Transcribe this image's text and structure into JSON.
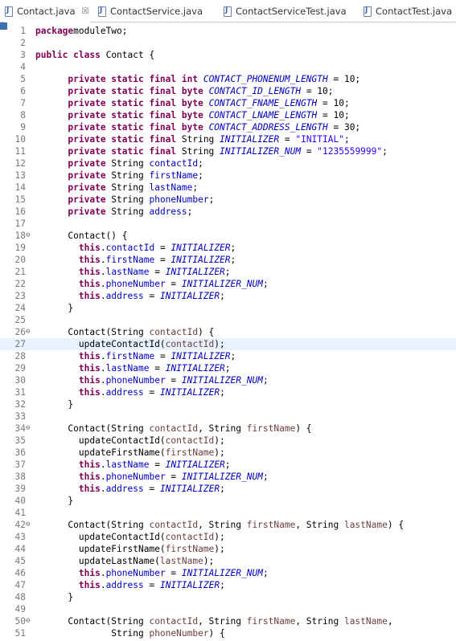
{
  "tabs": [
    {
      "label": "Contact.java",
      "close": "☒",
      "active": true
    },
    {
      "label": "ContactService.java"
    },
    {
      "label": "ContactServiceTest.java"
    },
    {
      "label": "ContactTest.java"
    }
  ],
  "current_line": 27,
  "lines": [
    {
      "n": "1",
      "t": [
        [
          "kw",
          "package"
        ],
        [
          "",
          "moduleTwo;"
        ]
      ]
    },
    {
      "n": "2",
      "t": []
    },
    {
      "n": "3",
      "t": [
        [
          "kw",
          "public"
        ],
        [
          "",
          ""
        ],
        [
          "kw",
          " class"
        ],
        [
          "",
          " Contact {"
        ]
      ]
    },
    {
      "n": "4",
      "t": []
    },
    {
      "n": "5",
      "t": [
        [
          "",
          "      "
        ],
        [
          "kw",
          "private static final int"
        ],
        [
          "",
          " "
        ],
        [
          "sfld",
          "CONTACT_PHONENUM_LENGTH"
        ],
        [
          "",
          " = 10;"
        ]
      ]
    },
    {
      "n": "6",
      "t": [
        [
          "",
          "      "
        ],
        [
          "kw",
          "private static final byte"
        ],
        [
          "",
          " "
        ],
        [
          "sfld",
          "CONTACT_ID_LENGTH"
        ],
        [
          "",
          " = 10;"
        ]
      ]
    },
    {
      "n": "7",
      "t": [
        [
          "",
          "      "
        ],
        [
          "kw",
          "private static final byte"
        ],
        [
          "",
          " "
        ],
        [
          "sfld",
          "CONTACT_FNAME_LENGTH"
        ],
        [
          "",
          " = 10;"
        ]
      ]
    },
    {
      "n": "8",
      "t": [
        [
          "",
          "      "
        ],
        [
          "kw",
          "private static final byte"
        ],
        [
          "",
          " "
        ],
        [
          "sfld",
          "CONTACT_LNAME_LENGTH"
        ],
        [
          "",
          " = 10;"
        ]
      ]
    },
    {
      "n": "9",
      "t": [
        [
          "",
          "      "
        ],
        [
          "kw",
          "private static final byte"
        ],
        [
          "",
          " "
        ],
        [
          "sfld",
          "CONTACT_ADDRESS_LENGTH"
        ],
        [
          "",
          " = 30;"
        ]
      ]
    },
    {
      "n": "10",
      "t": [
        [
          "",
          "      "
        ],
        [
          "kw",
          "private static final"
        ],
        [
          "",
          " String "
        ],
        [
          "sfld",
          "INITIALIZER"
        ],
        [
          "",
          " = "
        ],
        [
          "str",
          "\"INITIAL\""
        ],
        [
          "",
          ";"
        ]
      ]
    },
    {
      "n": "11",
      "t": [
        [
          "",
          "      "
        ],
        [
          "kw",
          "private static final"
        ],
        [
          "",
          " String "
        ],
        [
          "sfld",
          "INITIALIZER_NUM"
        ],
        [
          "",
          " = "
        ],
        [
          "str",
          "\"1235559999\""
        ],
        [
          "",
          ";"
        ]
      ]
    },
    {
      "n": "12",
      "t": [
        [
          "",
          "      "
        ],
        [
          "kw",
          "private"
        ],
        [
          "",
          " String "
        ],
        [
          "fld",
          "contactId"
        ],
        [
          "",
          ";"
        ]
      ]
    },
    {
      "n": "13",
      "t": [
        [
          "",
          "      "
        ],
        [
          "kw",
          "private"
        ],
        [
          "",
          " String "
        ],
        [
          "fld",
          "firstName"
        ],
        [
          "",
          ";"
        ]
      ]
    },
    {
      "n": "14",
      "t": [
        [
          "",
          "      "
        ],
        [
          "kw",
          "private"
        ],
        [
          "",
          " String "
        ],
        [
          "fld",
          "lastName"
        ],
        [
          "",
          ";"
        ]
      ]
    },
    {
      "n": "15",
      "t": [
        [
          "",
          "      "
        ],
        [
          "kw",
          "private"
        ],
        [
          "",
          " String "
        ],
        [
          "fld",
          "phoneNumber"
        ],
        [
          "",
          ";"
        ]
      ]
    },
    {
      "n": "16",
      "t": [
        [
          "",
          "      "
        ],
        [
          "kw",
          "private"
        ],
        [
          "",
          " String "
        ],
        [
          "fld",
          "address"
        ],
        [
          "",
          ";"
        ]
      ]
    },
    {
      "n": "17",
      "t": []
    },
    {
      "n": "18",
      "fold": "⊖",
      "t": [
        [
          "",
          "      Contact() {"
        ]
      ]
    },
    {
      "n": "19",
      "t": [
        [
          "",
          "        "
        ],
        [
          "kw",
          "this"
        ],
        [
          "",
          "."
        ],
        [
          "fld",
          "contactId"
        ],
        [
          "",
          " = "
        ],
        [
          "sfld",
          "INITIALIZER"
        ],
        [
          "",
          ";"
        ]
      ]
    },
    {
      "n": "20",
      "t": [
        [
          "",
          "        "
        ],
        [
          "kw",
          "this"
        ],
        [
          "",
          "."
        ],
        [
          "fld",
          "firstName"
        ],
        [
          "",
          " = "
        ],
        [
          "sfld",
          "INITIALIZER"
        ],
        [
          "",
          ";"
        ]
      ]
    },
    {
      "n": "21",
      "t": [
        [
          "",
          "        "
        ],
        [
          "kw",
          "this"
        ],
        [
          "",
          "."
        ],
        [
          "fld",
          "lastName"
        ],
        [
          "",
          " = "
        ],
        [
          "sfld",
          "INITIALIZER"
        ],
        [
          "",
          ";"
        ]
      ]
    },
    {
      "n": "22",
      "t": [
        [
          "",
          "        "
        ],
        [
          "kw",
          "this"
        ],
        [
          "",
          "."
        ],
        [
          "fld",
          "phoneNumber"
        ],
        [
          "",
          " = "
        ],
        [
          "sfld",
          "INITIALIZER_NUM"
        ],
        [
          "",
          ";"
        ]
      ]
    },
    {
      "n": "23",
      "t": [
        [
          "",
          "        "
        ],
        [
          "kw",
          "this"
        ],
        [
          "",
          "."
        ],
        [
          "fld",
          "address"
        ],
        [
          "",
          " = "
        ],
        [
          "sfld",
          "INITIALIZER"
        ],
        [
          "",
          ";"
        ]
      ]
    },
    {
      "n": "24",
      "t": [
        [
          "",
          "      }"
        ]
      ]
    },
    {
      "n": "25",
      "t": []
    },
    {
      "n": "26",
      "fold": "⊖",
      "t": [
        [
          "",
          "      Contact(String "
        ],
        [
          "var",
          "contactId"
        ],
        [
          "",
          ") {"
        ]
      ]
    },
    {
      "n": "27",
      "t": [
        [
          "",
          "        updateContactId("
        ],
        [
          "var",
          "contactId"
        ],
        [
          "",
          ");"
        ]
      ]
    },
    {
      "n": "28",
      "t": [
        [
          "",
          "        "
        ],
        [
          "kw",
          "this"
        ],
        [
          "",
          "."
        ],
        [
          "fld",
          "firstName"
        ],
        [
          "",
          " = "
        ],
        [
          "sfld",
          "INITIALIZER"
        ],
        [
          "",
          ";"
        ]
      ]
    },
    {
      "n": "29",
      "t": [
        [
          "",
          "        "
        ],
        [
          "kw",
          "this"
        ],
        [
          "",
          "."
        ],
        [
          "fld",
          "lastName"
        ],
        [
          "",
          " = "
        ],
        [
          "sfld",
          "INITIALIZER"
        ],
        [
          "",
          ";"
        ]
      ]
    },
    {
      "n": "30",
      "t": [
        [
          "",
          "        "
        ],
        [
          "kw",
          "this"
        ],
        [
          "",
          "."
        ],
        [
          "fld",
          "phoneNumber"
        ],
        [
          "",
          " = "
        ],
        [
          "sfld",
          "INITIALIZER_NUM"
        ],
        [
          "",
          ";"
        ]
      ]
    },
    {
      "n": "31",
      "t": [
        [
          "",
          "        "
        ],
        [
          "kw",
          "this"
        ],
        [
          "",
          "."
        ],
        [
          "fld",
          "address"
        ],
        [
          "",
          " = "
        ],
        [
          "sfld",
          "INITIALIZER"
        ],
        [
          "",
          ";"
        ]
      ]
    },
    {
      "n": "32",
      "t": [
        [
          "",
          "      }"
        ]
      ]
    },
    {
      "n": "33",
      "t": []
    },
    {
      "n": "34",
      "fold": "⊖",
      "t": [
        [
          "",
          "      Contact(String "
        ],
        [
          "var",
          "contactId"
        ],
        [
          "",
          ", String "
        ],
        [
          "var",
          "firstName"
        ],
        [
          "",
          ") {"
        ]
      ]
    },
    {
      "n": "35",
      "t": [
        [
          "",
          "        updateContactId("
        ],
        [
          "var",
          "contactId"
        ],
        [
          "",
          ");"
        ]
      ]
    },
    {
      "n": "36",
      "t": [
        [
          "",
          "        updateFirstName("
        ],
        [
          "var",
          "firstName"
        ],
        [
          "",
          ");"
        ]
      ]
    },
    {
      "n": "37",
      "t": [
        [
          "",
          "        "
        ],
        [
          "kw",
          "this"
        ],
        [
          "",
          "."
        ],
        [
          "fld",
          "lastName"
        ],
        [
          "",
          " = "
        ],
        [
          "sfld",
          "INITIALIZER"
        ],
        [
          "",
          ";"
        ]
      ]
    },
    {
      "n": "38",
      "t": [
        [
          "",
          "        "
        ],
        [
          "kw",
          "this"
        ],
        [
          "",
          "."
        ],
        [
          "fld",
          "phoneNumber"
        ],
        [
          "",
          " = "
        ],
        [
          "sfld",
          "INITIALIZER_NUM"
        ],
        [
          "",
          ";"
        ]
      ]
    },
    {
      "n": "39",
      "t": [
        [
          "",
          "        "
        ],
        [
          "kw",
          "this"
        ],
        [
          "",
          "."
        ],
        [
          "fld",
          "address"
        ],
        [
          "",
          " = "
        ],
        [
          "sfld",
          "INITIALIZER"
        ],
        [
          "",
          ";"
        ]
      ]
    },
    {
      "n": "40",
      "t": [
        [
          "",
          "      }"
        ]
      ]
    },
    {
      "n": "41",
      "t": []
    },
    {
      "n": "42",
      "fold": "⊖",
      "t": [
        [
          "",
          "      Contact(String "
        ],
        [
          "var",
          "contactId"
        ],
        [
          "",
          ", String "
        ],
        [
          "var",
          "firstName"
        ],
        [
          "",
          ", String "
        ],
        [
          "var",
          "lastName"
        ],
        [
          "",
          ") {"
        ]
      ]
    },
    {
      "n": "43",
      "t": [
        [
          "",
          "        updateContactId("
        ],
        [
          "var",
          "contactId"
        ],
        [
          "",
          ");"
        ]
      ]
    },
    {
      "n": "44",
      "t": [
        [
          "",
          "        updateFirstName("
        ],
        [
          "var",
          "firstName"
        ],
        [
          "",
          ");"
        ]
      ]
    },
    {
      "n": "45",
      "t": [
        [
          "",
          "        updateLastName("
        ],
        [
          "var",
          "lastName"
        ],
        [
          "",
          ");"
        ]
      ]
    },
    {
      "n": "46",
      "t": [
        [
          "",
          "        "
        ],
        [
          "kw",
          "this"
        ],
        [
          "",
          "."
        ],
        [
          "fld",
          "phoneNumber"
        ],
        [
          "",
          " = "
        ],
        [
          "sfld",
          "INITIALIZER_NUM"
        ],
        [
          "",
          ";"
        ]
      ]
    },
    {
      "n": "47",
      "t": [
        [
          "",
          "        "
        ],
        [
          "kw",
          "this"
        ],
        [
          "",
          "."
        ],
        [
          "fld",
          "address"
        ],
        [
          "",
          " = "
        ],
        [
          "sfld",
          "INITIALIZER"
        ],
        [
          "",
          ";"
        ]
      ]
    },
    {
      "n": "48",
      "t": [
        [
          "",
          "      }"
        ]
      ]
    },
    {
      "n": "49",
      "t": []
    },
    {
      "n": "50",
      "fold": "⊖",
      "t": [
        [
          "",
          "      Contact(String "
        ],
        [
          "var",
          "contactId"
        ],
        [
          "",
          ", String "
        ],
        [
          "var",
          "firstName"
        ],
        [
          "",
          ", String "
        ],
        [
          "var",
          "lastName"
        ],
        [
          "",
          ","
        ]
      ]
    },
    {
      "n": "51",
      "t": [
        [
          "",
          "              String "
        ],
        [
          "var",
          "phoneNumber"
        ],
        [
          "",
          ") {"
        ]
      ]
    }
  ]
}
